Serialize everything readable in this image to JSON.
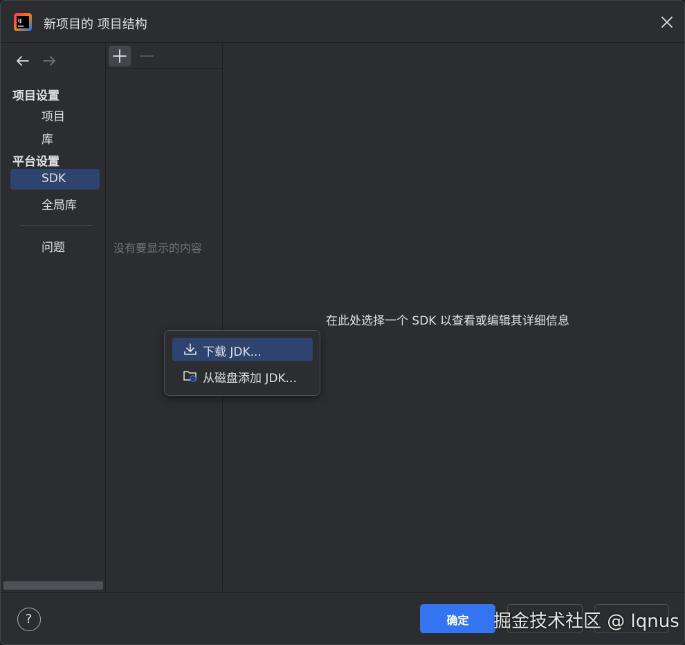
{
  "window": {
    "title": "新项目的 项目结构",
    "app_icon": "intellij-idea-icon",
    "close_icon": "close-icon",
    "app_icon_text": "IJ"
  },
  "nav": {
    "back_icon": "arrow-left-icon",
    "forward_icon": "arrow-right-icon",
    "project_settings_title": "项目设置",
    "platform_settings_title": "平台设置",
    "items": [
      {
        "label": "项目",
        "selected": false
      },
      {
        "label": "库",
        "selected": false
      },
      {
        "label": "SDK",
        "selected": true
      },
      {
        "label": "全局库",
        "selected": false
      },
      {
        "label": "问题",
        "selected": false
      }
    ]
  },
  "list": {
    "add_icon": "plus-icon",
    "remove_icon": "minus-icon",
    "empty_text": "没有要显示的内容"
  },
  "details": {
    "hint": "在此处选择一个 SDK 以查看或编辑其详细信息"
  },
  "popup": {
    "items": [
      {
        "label": "下载 JDK...",
        "icon": "download-icon",
        "selected": true
      },
      {
        "label": "从磁盘添加 JDK...",
        "icon": "folder-icon",
        "selected": false
      }
    ]
  },
  "footer": {
    "help_label": "?",
    "ok_label": "确定"
  },
  "watermark": "掘金技术社区 @ lqnus",
  "colors": {
    "background": "#2b2d30",
    "selection": "#2e436e",
    "accent": "#3574f0",
    "text": "#dfe1e5",
    "muted_text": "#6f737a"
  }
}
